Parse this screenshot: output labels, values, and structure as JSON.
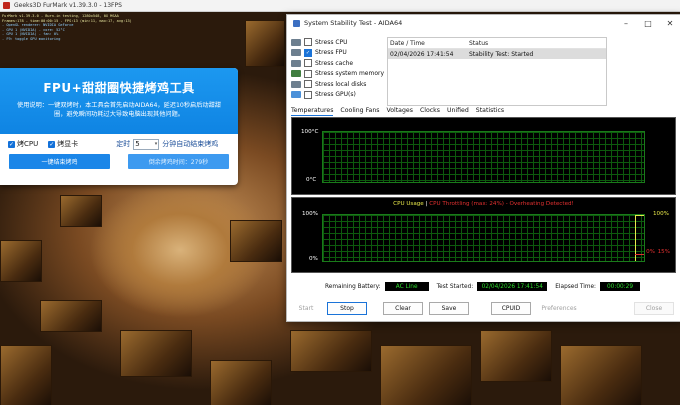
{
  "furmark": {
    "title": "Geeks3D FurMark v1.39.3.0 - 13FPS",
    "overlay_lines": [
      "FurMark v1.39.3.0 - Burn-in testing, 1280x548, 0X MSAA",
      "Frames:178 - time:00:00:15 - FPS:13 (min:11, max:17, avg:13)",
      "- OpenGL renderer: NVIDIA GeForce",
      "- GPU 1 (NVIDIA) - core: 52°C",
      "- GPU 1 (NVIDIA) - fan: 0%",
      "- F9: toggle GPU monitoring"
    ]
  },
  "tool": {
    "title": "FPU+甜甜圈快捷烤鸡工具",
    "desc": "使用说明：一键双烤时，本工具会首先启动AIDA64，延迟10秒启后动甜甜圈，避免瞬间功耗过大导致电脑出现其他问题。",
    "opt_cpu": "烤CPU",
    "opt_gpu": "烤显卡",
    "timer_label_pre": "定时",
    "timer_value": "5",
    "timer_label_post": "分钟自动结束烤鸡",
    "btn_end": "一键结束烤鸡",
    "btn_start": "倒余烤鸡时间：279秒"
  },
  "aida": {
    "title": "System Stability Test - AIDA64",
    "stress_items": [
      {
        "label": "Stress CPU",
        "checked": false
      },
      {
        "label": "Stress FPU",
        "checked": true
      },
      {
        "label": "Stress cache",
        "checked": false
      },
      {
        "label": "Stress system memory",
        "checked": false
      },
      {
        "label": "Stress local disks",
        "checked": false
      },
      {
        "label": "Stress GPU(s)",
        "checked": false
      }
    ],
    "log_headers": [
      "Date / Time",
      "Status"
    ],
    "log_rows": [
      [
        "02/04/2026 17:41:54",
        "Stability Test: Started"
      ]
    ],
    "tabs": [
      "Temperatures",
      "Cooling Fans",
      "Voltages",
      "Clocks",
      "Unified",
      "Statistics"
    ],
    "temp_graph": {
      "top_label": "100°C",
      "bottom_label": "0°C"
    },
    "cpu_graph": {
      "title_usage": "CPU Usage",
      "separator": "|",
      "title_throttle": "CPU Throttling (max: 24%) - Overheating Detected!",
      "top_left": "100%",
      "bottom_left": "0%",
      "right_top": "100%",
      "right_bottom_a": "0%",
      "right_bottom_b": "15%"
    },
    "status": {
      "battery_label": "Remaining Battery:",
      "battery_value": "AC Line",
      "started_label": "Test Started:",
      "started_value": "02/04/2026 17:41:54",
      "elapsed_label": "Elapsed Time:",
      "elapsed_value": "00:00:29"
    },
    "buttons": {
      "start": "Start",
      "stop": "Stop",
      "clear": "Clear",
      "save": "Save",
      "cpuid": "CPUID",
      "prefs": "Preferences",
      "close": "Close"
    }
  },
  "colors": {
    "tool_blue": "#1b86e8",
    "graph_green": "#2ede2e",
    "warning_red": "#e23030",
    "usage_yellow": "#e8e84a"
  }
}
